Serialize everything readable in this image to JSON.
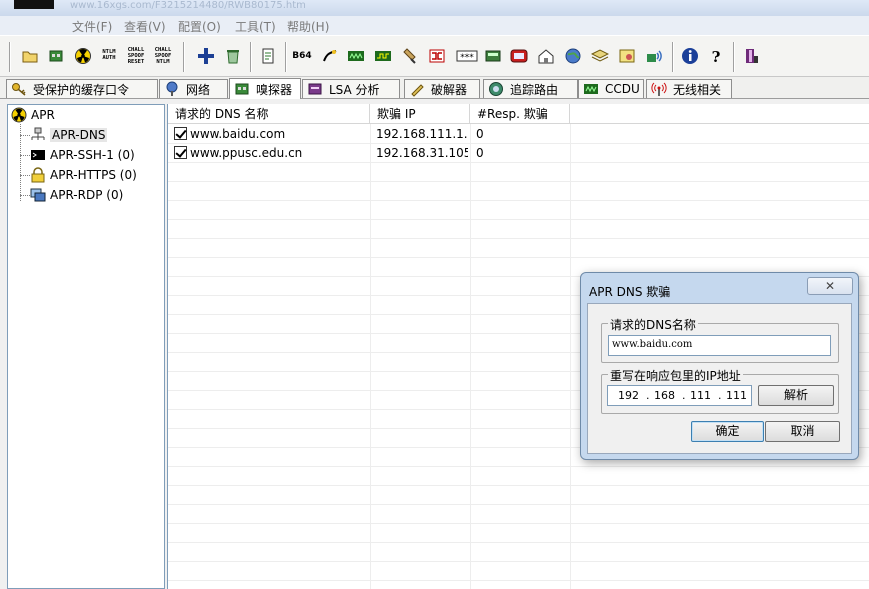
{
  "window": {
    "url_ghost": "www.16xgs.com/F3215214480/RWB80175.htm"
  },
  "menu": [
    "文件(F)",
    "查看(V)",
    "配置(O)",
    "工具(T)",
    "帮助(H)"
  ],
  "toolbar": {
    "ntlm_auth": "NTLM\nAUTH",
    "chall_spoof_reset": "CHALL\nSPOOF\nRESET",
    "chall_spoof_ntlm": "CHALL\nSPOOF\nNTLM",
    "b64": "B64",
    "stars": "***"
  },
  "tabs": [
    {
      "label": "受保护的缓存口令",
      "icon": "key-icon"
    },
    {
      "label": "网络",
      "icon": "network-icon"
    },
    {
      "label": "嗅探器",
      "icon": "sniffer-icon"
    },
    {
      "label": "LSA 分析",
      "icon": "lsa-icon"
    },
    {
      "label": "破解器",
      "icon": "cracker-icon"
    },
    {
      "label": "追踪路由",
      "icon": "traceroute-icon"
    },
    {
      "label": "CCDU",
      "icon": "ccdu-icon"
    },
    {
      "label": "无线相关",
      "icon": "wireless-icon"
    }
  ],
  "tree": {
    "root": "APR",
    "children": [
      "APR-DNS",
      "APR-SSH-1 (0)",
      "APR-HTTPS (0)",
      "APR-RDP (0)"
    ]
  },
  "table": {
    "columns": [
      "请求的 DNS 名称",
      "欺骗 IP",
      "#Resp. 欺骗"
    ],
    "rows": [
      {
        "name": "www.baidu.com",
        "ip": "192.168.111.1...",
        "resp": "0"
      },
      {
        "name": "www.ppusc.edu.cn",
        "ip": "192.168.31.105",
        "resp": "0"
      }
    ]
  },
  "dialog": {
    "title": "APR DNS 欺骗",
    "close_glyph": "✕",
    "dns_group_label": "请求的DNS名称",
    "dns_value": "www.baidu.com",
    "ip_group_label": "重写在响应包里的IP地址",
    "ip": [
      "192",
      "168",
      "111",
      "111"
    ],
    "ip_sep": ".",
    "resolve_button": "解析",
    "ok_button": "确定",
    "cancel_button": "取消"
  }
}
